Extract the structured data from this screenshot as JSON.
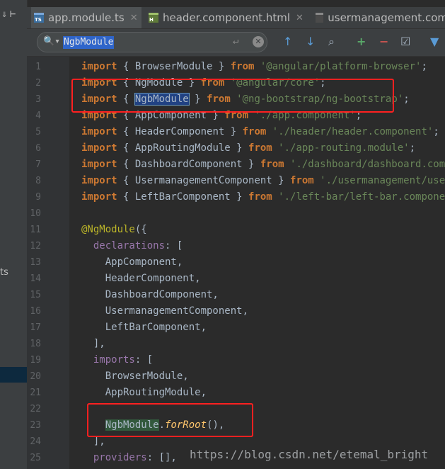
{
  "sidebar": {
    "partial_text": "ts",
    "top_icons": [
      "collapse-icon",
      "scroll-from-source-icon"
    ]
  },
  "tabs": [
    {
      "label": "app.module.ts",
      "type": "ts",
      "active": true,
      "icon_text": "TS"
    },
    {
      "label": "header.component.html",
      "type": "html",
      "active": false,
      "icon_text": "H"
    },
    {
      "label": "usermanagement.com",
      "type": "class",
      "active": false,
      "icon_text": ""
    }
  ],
  "search": {
    "value": "NgbModule",
    "placeholder": ""
  },
  "toolbar": {
    "up_arrow": "↑",
    "down_arrow": "↓",
    "find_all": "⌕",
    "add_occurrence": "+",
    "remove_occurrence": "−",
    "select_all": "☑",
    "filter": "▼"
  },
  "code": {
    "lines": [
      {
        "n": "1",
        "tokens": [
          [
            "kw",
            "import"
          ],
          [
            "br",
            " { BrowserModule } "
          ],
          [
            "kw",
            "from"
          ],
          [
            "str",
            " '@angular/platform-browser'"
          ],
          [
            "br",
            ";"
          ]
        ]
      },
      {
        "n": "2",
        "tokens": [
          [
            "kw",
            "import"
          ],
          [
            "br",
            " { NgModule } "
          ],
          [
            "kw",
            "from"
          ],
          [
            "str",
            " '@angular/core'"
          ],
          [
            "br",
            ";"
          ]
        ]
      },
      {
        "n": "3",
        "tokens": [
          [
            "kw",
            "import"
          ],
          [
            "br",
            " { "
          ],
          [
            "hl",
            "NgbModule"
          ],
          [
            "br",
            " } "
          ],
          [
            "kw",
            "from"
          ],
          [
            "str",
            " '@ng-bootstrap/ng-bootstrap'"
          ],
          [
            "br",
            ";"
          ]
        ]
      },
      {
        "n": "4",
        "tokens": [
          [
            "kw",
            "import"
          ],
          [
            "br",
            " { AppComponent } "
          ],
          [
            "kw",
            "from"
          ],
          [
            "str",
            " './app.component'"
          ],
          [
            "br",
            ";"
          ]
        ]
      },
      {
        "n": "5",
        "tokens": [
          [
            "kw",
            "import"
          ],
          [
            "br",
            " { HeaderComponent } "
          ],
          [
            "kw",
            "from"
          ],
          [
            "str",
            " './header/header.component'"
          ],
          [
            "br",
            ";"
          ]
        ]
      },
      {
        "n": "6",
        "tokens": [
          [
            "kw",
            "import"
          ],
          [
            "br",
            " { AppRoutingModule } "
          ],
          [
            "kw",
            "from"
          ],
          [
            "str",
            " './app-routing.module'"
          ],
          [
            "br",
            ";"
          ]
        ]
      },
      {
        "n": "7",
        "tokens": [
          [
            "kw",
            "import"
          ],
          [
            "br",
            " { DashboardComponent } "
          ],
          [
            "kw",
            "from"
          ],
          [
            "str",
            " './dashboard/dashboard.compo"
          ]
        ]
      },
      {
        "n": "8",
        "tokens": [
          [
            "kw",
            "import"
          ],
          [
            "br",
            " { UsermanagementComponent } "
          ],
          [
            "kw",
            "from"
          ],
          [
            "str",
            " './usermanagement/userm"
          ]
        ]
      },
      {
        "n": "9",
        "tokens": [
          [
            "kw",
            "import"
          ],
          [
            "br",
            " { LeftBarComponent } "
          ],
          [
            "kw",
            "from"
          ],
          [
            "str",
            " './left-bar/left-bar.component"
          ]
        ]
      },
      {
        "n": "10",
        "tokens": []
      },
      {
        "n": "11",
        "tokens": [
          [
            "ann",
            "@NgModule"
          ],
          [
            "br",
            "({"
          ]
        ]
      },
      {
        "n": "12",
        "tokens": [
          [
            "br",
            "  "
          ],
          [
            "prop",
            "declarations"
          ],
          [
            "br",
            ": ["
          ]
        ]
      },
      {
        "n": "13",
        "tokens": [
          [
            "br",
            "    AppComponent,"
          ]
        ]
      },
      {
        "n": "14",
        "tokens": [
          [
            "br",
            "    HeaderComponent,"
          ]
        ]
      },
      {
        "n": "15",
        "tokens": [
          [
            "br",
            "    DashboardComponent,"
          ]
        ]
      },
      {
        "n": "16",
        "tokens": [
          [
            "br",
            "    UsermanagementComponent,"
          ]
        ]
      },
      {
        "n": "17",
        "tokens": [
          [
            "br",
            "    LeftBarComponent,"
          ]
        ]
      },
      {
        "n": "18",
        "tokens": [
          [
            "br",
            "  ],"
          ]
        ]
      },
      {
        "n": "19",
        "tokens": [
          [
            "br",
            "  "
          ],
          [
            "prop",
            "imports"
          ],
          [
            "br",
            ": ["
          ]
        ]
      },
      {
        "n": "20",
        "tokens": [
          [
            "br",
            "    BrowserModule,"
          ]
        ]
      },
      {
        "n": "21",
        "tokens": [
          [
            "br",
            "    AppRoutingModule,"
          ]
        ]
      },
      {
        "n": "22",
        "tokens": []
      },
      {
        "n": "23",
        "tokens": [
          [
            "br",
            "    "
          ],
          [
            "hl2",
            "NgbModule"
          ],
          [
            "br",
            "."
          ],
          [
            "mth",
            "forRoot"
          ],
          [
            "br",
            "(),"
          ]
        ]
      },
      {
        "n": "24",
        "tokens": [
          [
            "br",
            "  ],"
          ]
        ]
      },
      {
        "n": "25",
        "tokens": [
          [
            "br",
            "  "
          ],
          [
            "prop",
            "providers"
          ],
          [
            "br",
            ": [],"
          ]
        ]
      }
    ]
  },
  "watermark": "https://blog.csdn.net/etemal_bright",
  "colors": {
    "keyword": "#cc7832",
    "string": "#6a8759",
    "annotation": "#bbb529",
    "property": "#9876aa",
    "method": "#ffc66d",
    "highlight_box": "#ff2020"
  }
}
